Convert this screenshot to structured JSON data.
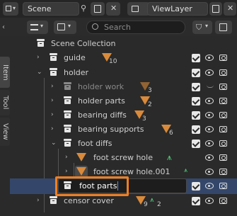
{
  "header": {
    "left_editor": "Scene",
    "right_editor": "ViewLayer"
  },
  "toolbar": {
    "search_placeholder": "Search"
  },
  "side_tabs": [
    "Item",
    "Tool",
    "View"
  ],
  "outliner": {
    "scene_collection": "Scene Collection",
    "rows": [
      {
        "label": "guide",
        "badge": "10"
      },
      {
        "label": "holder"
      },
      {
        "label": "holder work",
        "badge": "3"
      },
      {
        "label": "holder parts",
        "badge": "2"
      },
      {
        "label": "bearing diffs",
        "badge": "3"
      },
      {
        "label": "bearing supports",
        "badge": "6"
      },
      {
        "label": "foot diffs"
      },
      {
        "label": "foot screw hole"
      },
      {
        "label": "foot screw hole.001"
      },
      {
        "label": "foot parts"
      },
      {
        "label": "censor cover",
        "badge_a": "9",
        "badge_b": "2"
      }
    ]
  },
  "colors": {
    "accent": "#f07f22",
    "selection": "#34476b",
    "object_icon": "#d98a3a",
    "mesh_icon": "#4fd07a"
  }
}
